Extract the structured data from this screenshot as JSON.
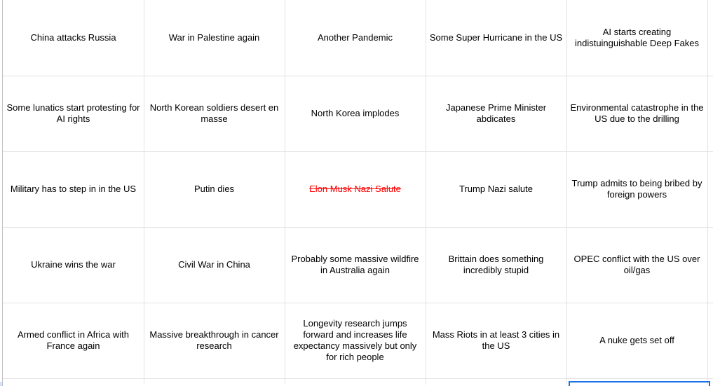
{
  "sheet": {
    "rows": [
      {
        "cells": [
          {
            "text": "China attacks Russia",
            "strikethrough": false
          },
          {
            "text": "War in Palestine again",
            "strikethrough": false
          },
          {
            "text": "Another Pandemic",
            "strikethrough": false
          },
          {
            "text": "Some Super Hurricane in the US",
            "strikethrough": false
          },
          {
            "text": "AI starts creating indistuinguishable Deep Fakes",
            "strikethrough": false
          }
        ]
      },
      {
        "cells": [
          {
            "text": "Some lunatics start protesting for AI rights",
            "strikethrough": false
          },
          {
            "text": "North Korean soldiers desert en masse",
            "strikethrough": false
          },
          {
            "text": "North Korea implodes",
            "strikethrough": false
          },
          {
            "text": "Japanese Prime Minister abdicates",
            "strikethrough": false
          },
          {
            "text": "Environmental catastrophe in the US due to the drilling",
            "strikethrough": false
          }
        ]
      },
      {
        "cells": [
          {
            "text": "Military has to step in in the US",
            "strikethrough": false
          },
          {
            "text": "Putin dies",
            "strikethrough": false
          },
          {
            "text": "Elon Musk Nazi Salute",
            "strikethrough": true
          },
          {
            "text": "Trump Nazi salute",
            "strikethrough": false
          },
          {
            "text": "Trump admits to being bribed by foreign powers",
            "strikethrough": false
          }
        ]
      },
      {
        "cells": [
          {
            "text": "Ukraine wins the war",
            "strikethrough": false
          },
          {
            "text": "Civil War in China",
            "strikethrough": false
          },
          {
            "text": "Probably some massive wildfire in Australia again",
            "strikethrough": false
          },
          {
            "text": "Brittain does something incredibly stupid",
            "strikethrough": false
          },
          {
            "text": "OPEC conflict with the US over oil/gas",
            "strikethrough": false
          }
        ]
      },
      {
        "cells": [
          {
            "text": "Armed conflict in Africa with France again",
            "strikethrough": false
          },
          {
            "text": "Massive breakthrough in cancer research",
            "strikethrough": false
          },
          {
            "text": "Longevity research jumps forward and increases life expectancy massively but only for rich people",
            "strikethrough": false
          },
          {
            "text": "Mass Riots in at least 3 cities in the US",
            "strikethrough": false
          },
          {
            "text": "A nuke gets set off",
            "strikethrough": false
          }
        ]
      }
    ],
    "colors": {
      "gridline": "#e2e2e2",
      "selection": "#1a73e8",
      "strike_text": "#ff0000",
      "row_header_selected": "#d3e3fd"
    }
  }
}
